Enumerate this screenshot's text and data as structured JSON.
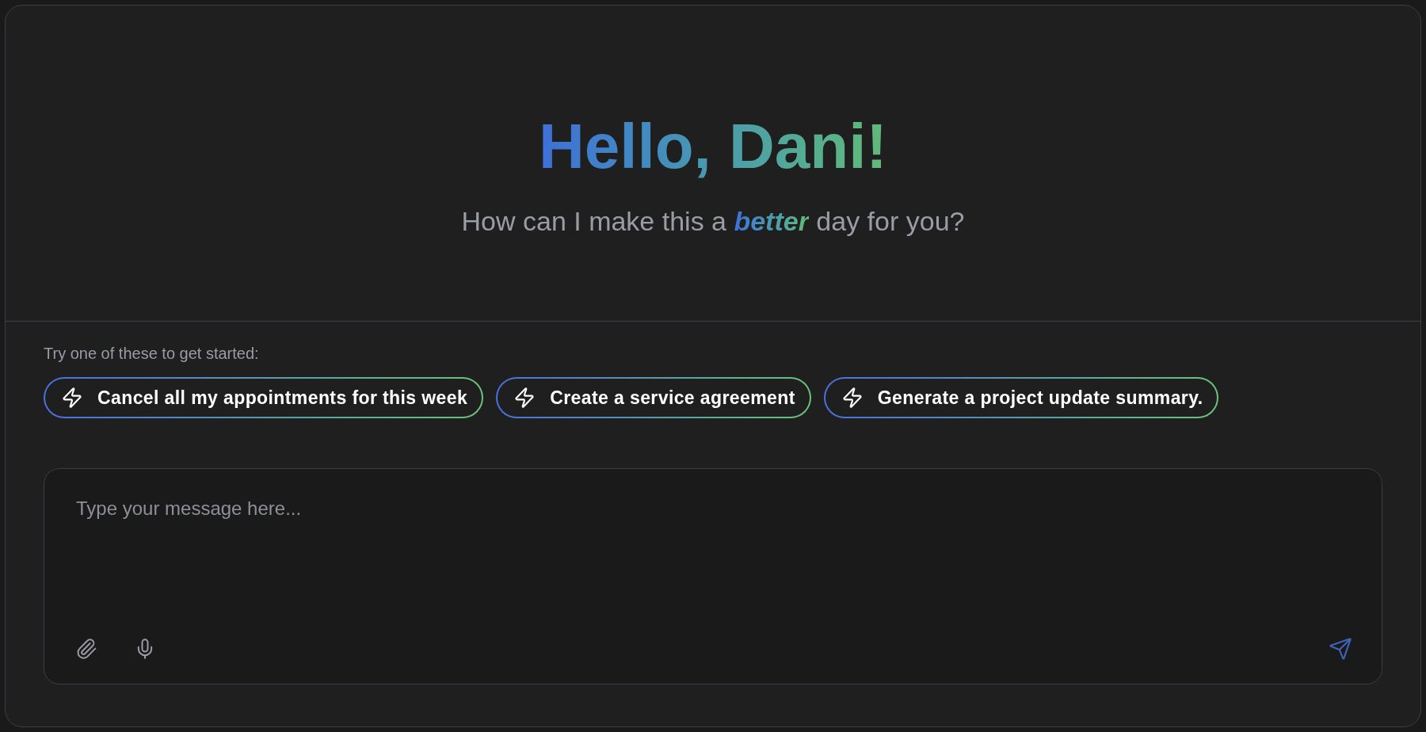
{
  "greeting": "Hello, Dani!",
  "subtitle": "How can I make this a **better** day for you?",
  "suggestions_label": "Try one of these to get started:",
  "suggestions": [
    "Cancel all my appointments for this week",
    "Create a service agreement",
    "Generate a project update summary."
  ],
  "composer": {
    "placeholder": "Type your message here..."
  }
}
